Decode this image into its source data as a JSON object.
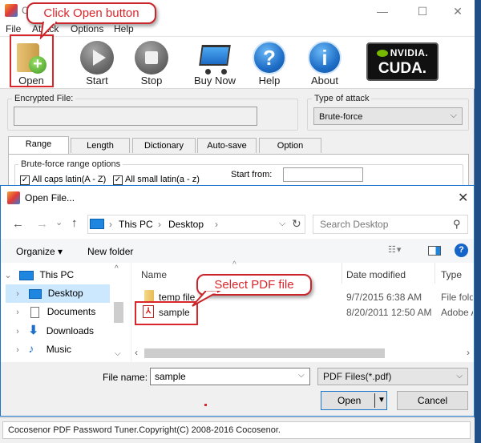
{
  "app": {
    "title_visible": "C",
    "window_controls": {
      "minimize": "—",
      "maximize": "☐",
      "close": "✕"
    },
    "menu": [
      "File",
      "Attack",
      "Options",
      "Help"
    ],
    "toolbar": [
      {
        "id": "open",
        "label": "Open",
        "icon": "folder-add-icon"
      },
      {
        "id": "start",
        "label": "Start",
        "icon": "play-icon"
      },
      {
        "id": "stop",
        "label": "Stop",
        "icon": "stop-icon"
      },
      {
        "id": "buy",
        "label": "Buy Now",
        "icon": "shopping-cart-icon"
      },
      {
        "id": "help",
        "label": "Help",
        "icon": "question-icon",
        "glyph": "?"
      },
      {
        "id": "about",
        "label": "About",
        "icon": "info-icon",
        "glyph": "i"
      }
    ],
    "cuda_logo": {
      "brand": "NVIDIA.",
      "product": "CUDA."
    },
    "encrypted_file": {
      "label": "Encrypted File:",
      "value": ""
    },
    "attack_type": {
      "label": "Type of attack",
      "selected": "Brute-force"
    },
    "tabs": [
      "Range",
      "Length",
      "Dictionary",
      "Auto-save",
      "Option"
    ],
    "active_tab": "Range",
    "range": {
      "group_label": "Brute-force range options",
      "options": [
        {
          "label": "All caps latin(A - Z)",
          "checked": true
        },
        {
          "label": "All small latin(a - z)",
          "checked": true
        }
      ],
      "start_from_label": "Start from:",
      "start_from_value": ""
    },
    "status_text": "Cocosenor PDF Password Tuner.Copyright(C) 2008-2016 Cocosenor."
  },
  "annotations": {
    "open_callout": "Click Open button",
    "select_callout": "Select PDF file",
    "highlight_color": "#d9262b"
  },
  "dialog": {
    "title": "Open File...",
    "close_glyph": "✕",
    "nav": {
      "back": "←",
      "forward": "→",
      "recent": "⌄",
      "up": "↑"
    },
    "breadcrumb": [
      "This PC",
      "Desktop"
    ],
    "refresh_glyph": "↻",
    "search_placeholder": "Search Desktop",
    "search_glyph": "⚲",
    "organize_label": "Organize ▾",
    "new_folder_label": "New folder",
    "help_glyph": "?",
    "nav_pane": [
      {
        "label": "This PC",
        "icon": "computer-icon",
        "expander": "⌄",
        "level": 0
      },
      {
        "label": "Desktop",
        "icon": "desktop-icon",
        "expander": "›",
        "level": 1,
        "selected": true
      },
      {
        "label": "Documents",
        "icon": "documents-icon",
        "expander": "›",
        "level": 1
      },
      {
        "label": "Downloads",
        "icon": "downloads-icon",
        "expander": "›",
        "level": 1
      },
      {
        "label": "Music",
        "icon": "music-icon",
        "expander": "›",
        "level": 1
      }
    ],
    "columns": [
      "Name",
      "Date modified",
      "Type"
    ],
    "files": [
      {
        "name": "temp file",
        "date": "9/7/2015 6:38 AM",
        "type": "File folder",
        "icon": "folder-icon"
      },
      {
        "name": "sample",
        "date": "8/20/2011 12:50 AM",
        "type": "Adobe Ac",
        "icon": "pdf-icon"
      }
    ],
    "file_name_label": "File name:",
    "file_name_value": "sample",
    "filter_selected": "PDF Files(*.pdf)",
    "open_button": "Open",
    "cancel_button": "Cancel"
  }
}
